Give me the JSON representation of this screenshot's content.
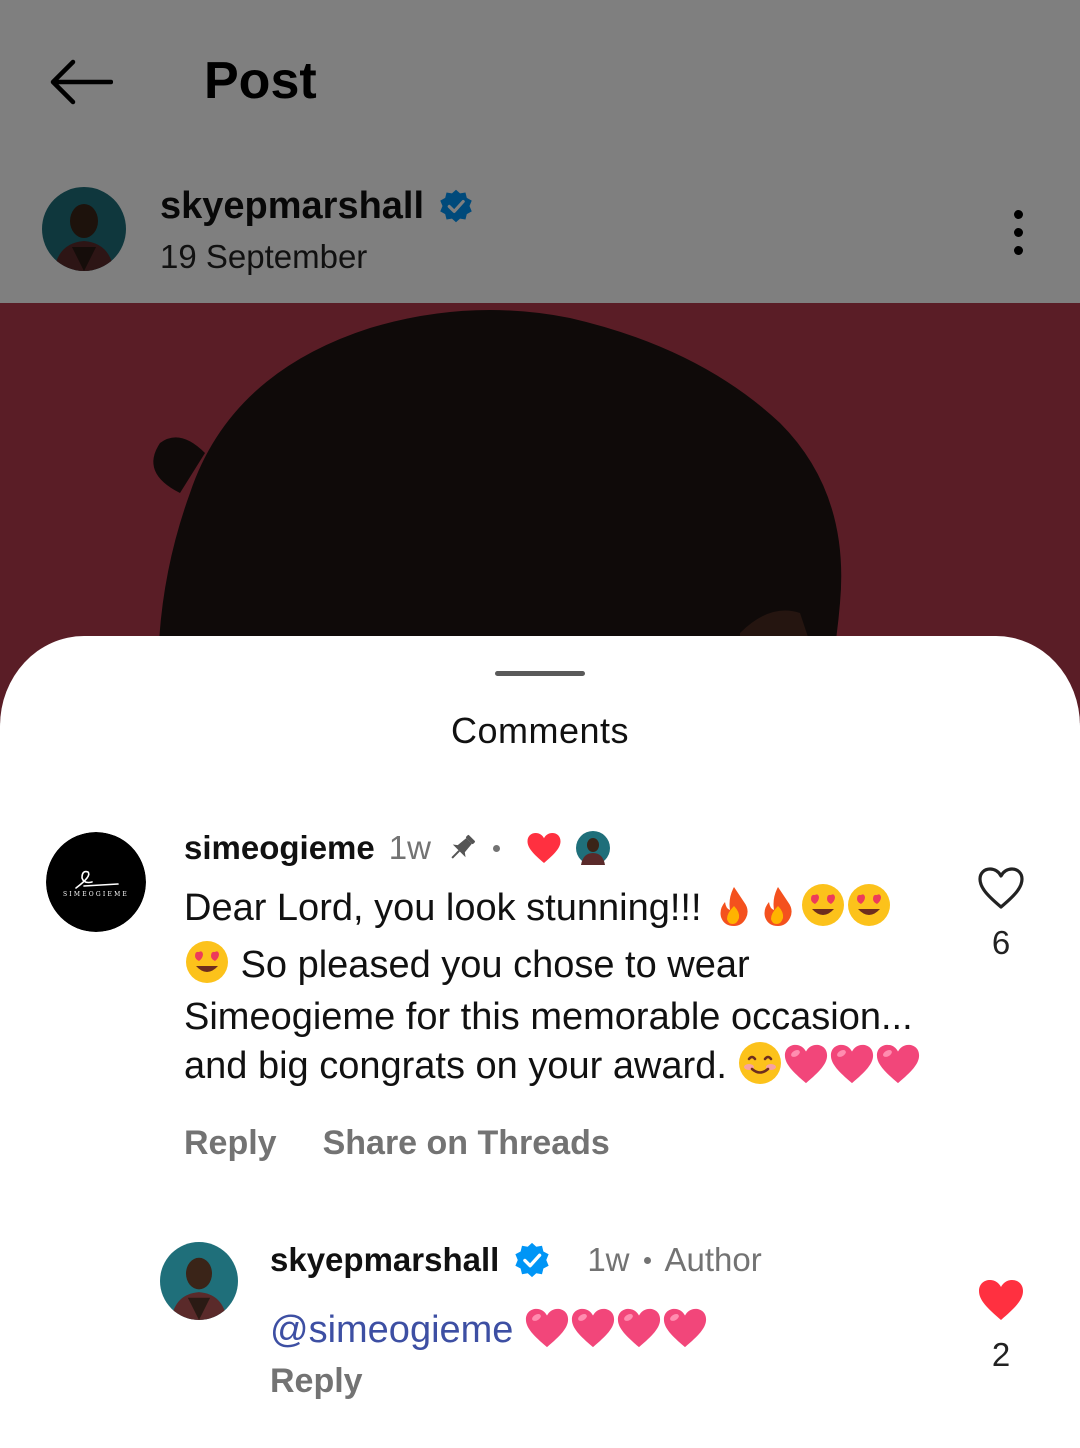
{
  "topbar": {
    "title": "Post",
    "back_icon": "arrow-left-icon"
  },
  "post": {
    "username": "skyepmarshall",
    "verified": true,
    "date": "19 September",
    "more_icon": "more-vertical-icon"
  },
  "comments_sheet": {
    "title": "Comments",
    "comments": [
      {
        "username": "simeogieme",
        "time": "1w",
        "pinned": true,
        "liked_by_author": true,
        "text_parts": [
          "Dear Lord, you look stunning!!!",
          "So pleased you chose to wear Simeogieme for this memorable occasion... and big congrats on your",
          "award."
        ],
        "emojis": [
          "🔥",
          "🔥",
          "😍",
          "😍",
          "😍",
          "😊",
          "💗",
          "💗",
          "💗"
        ],
        "actions": [
          "Reply",
          "Share on Threads"
        ],
        "like_count": "6",
        "liked": false
      },
      {
        "username": "skyepmarshall",
        "verified": true,
        "time": "1w",
        "badge": "Author",
        "mention": "@simeogieme",
        "emojis": [
          "💗",
          "💗",
          "💗",
          "💗"
        ],
        "actions": [
          "Reply"
        ],
        "like_count": "2",
        "liked": true
      }
    ]
  },
  "colors": {
    "verified_blue": "#0095f6",
    "like_red": "#ff3040",
    "muted_text": "#737373",
    "mention": "#3d4fa3",
    "post_bg": "#b53a4c"
  }
}
